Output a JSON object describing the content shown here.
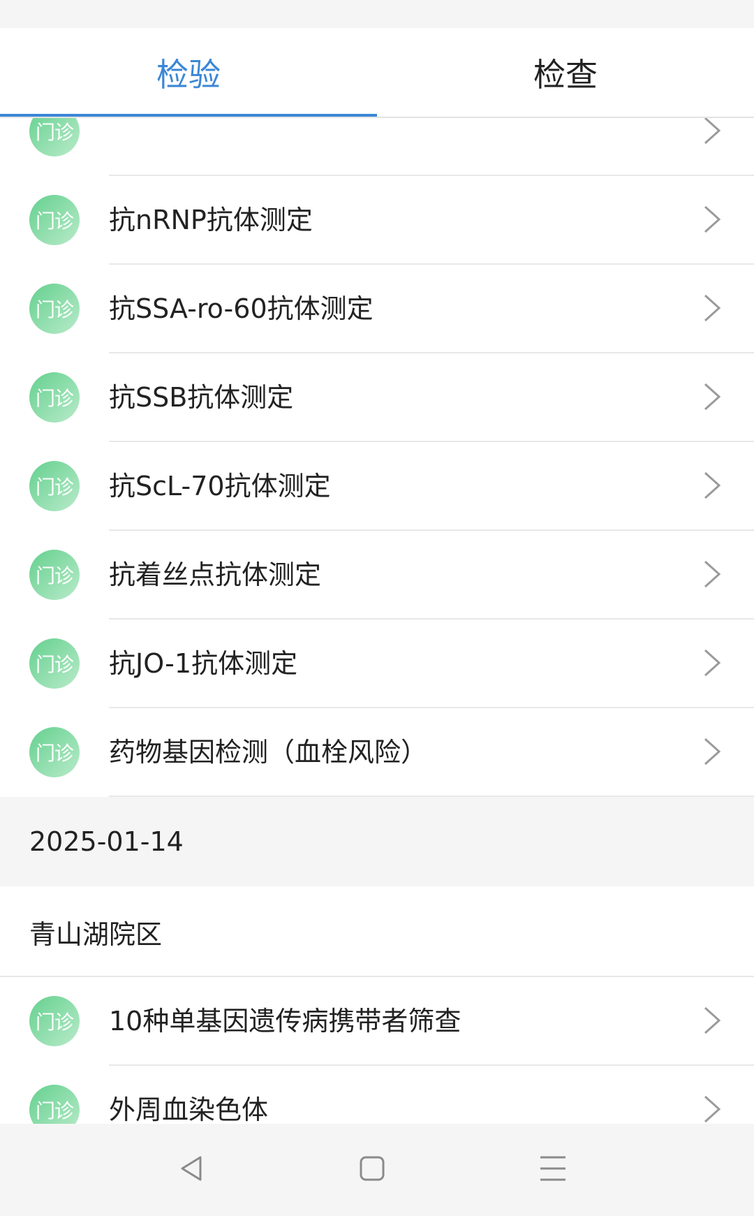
{
  "tabs": [
    {
      "label": "检验",
      "active": true
    },
    {
      "label": "检查",
      "active": false
    }
  ],
  "badge_text": "门诊",
  "colors": {
    "accent": "#3b87d6",
    "badge_gradient": [
      "#64d08e",
      "#b9ebca"
    ]
  },
  "group1": {
    "items": [
      {
        "name": ""
      },
      {
        "name": "抗nRNP抗体测定"
      },
      {
        "name": "抗SSA-ro-60抗体测定"
      },
      {
        "name": "抗SSB抗体测定"
      },
      {
        "name": "抗ScL-70抗体测定"
      },
      {
        "name": "抗着丝点抗体测定"
      },
      {
        "name": "抗JO-1抗体测定"
      },
      {
        "name": "药物基因检测（血栓风险）"
      }
    ]
  },
  "group2": {
    "date": "2025-01-14",
    "campus": "青山湖院区",
    "items": [
      {
        "name": "10种单基因遗传病携带者筛查"
      },
      {
        "name": "外周血染色体"
      }
    ]
  },
  "navbar": {
    "icons": [
      "back-icon",
      "home-icon",
      "menu-icon"
    ]
  }
}
